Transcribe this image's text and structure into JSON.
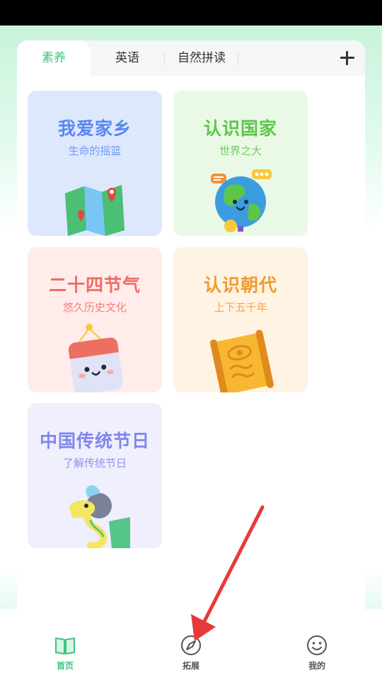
{
  "tabs": [
    {
      "label": "素养",
      "active": true
    },
    {
      "label": "英语",
      "active": false
    },
    {
      "label": "自然拼读",
      "active": false
    }
  ],
  "add_icon": "plus-icon",
  "cards": [
    {
      "title": "我爱家乡",
      "subtitle": "生命的摇篮",
      "bg": "#dde8fd",
      "title_color": "#5a86ef",
      "sub_color": "#6f9af2",
      "illustration": "map-icon"
    },
    {
      "title": "认识国家",
      "subtitle": "世界之大",
      "bg": "#eaf9e6",
      "title_color": "#5cc649",
      "sub_color": "#6fcd5d",
      "illustration": "globe-icon"
    },
    {
      "title": "二十四节气",
      "subtitle": "悠久历史文化",
      "bg": "#ffeceb",
      "title_color": "#ee6e62",
      "sub_color": "#f0837a",
      "illustration": "calendar-icon"
    },
    {
      "title": "认识朝代",
      "subtitle": "上下五千年",
      "bg": "#fff4e3",
      "title_color": "#ef9a32",
      "sub_color": "#f0a64d",
      "illustration": "scroll-icon"
    },
    {
      "title": "中国传统节日",
      "subtitle": "了解传统节日",
      "bg": "#efeffd",
      "title_color": "#7f86ee",
      "sub_color": "#8e94ef",
      "illustration": "dragon-icon"
    }
  ],
  "nav": [
    {
      "label": "首页",
      "icon": "book-icon",
      "active": true
    },
    {
      "label": "拓展",
      "icon": "compass-icon",
      "active": false
    },
    {
      "label": "我的",
      "icon": "smiley-icon",
      "active": false
    }
  ],
  "colors": {
    "accent": "#3cc47c",
    "arrow": "#e8393a"
  }
}
